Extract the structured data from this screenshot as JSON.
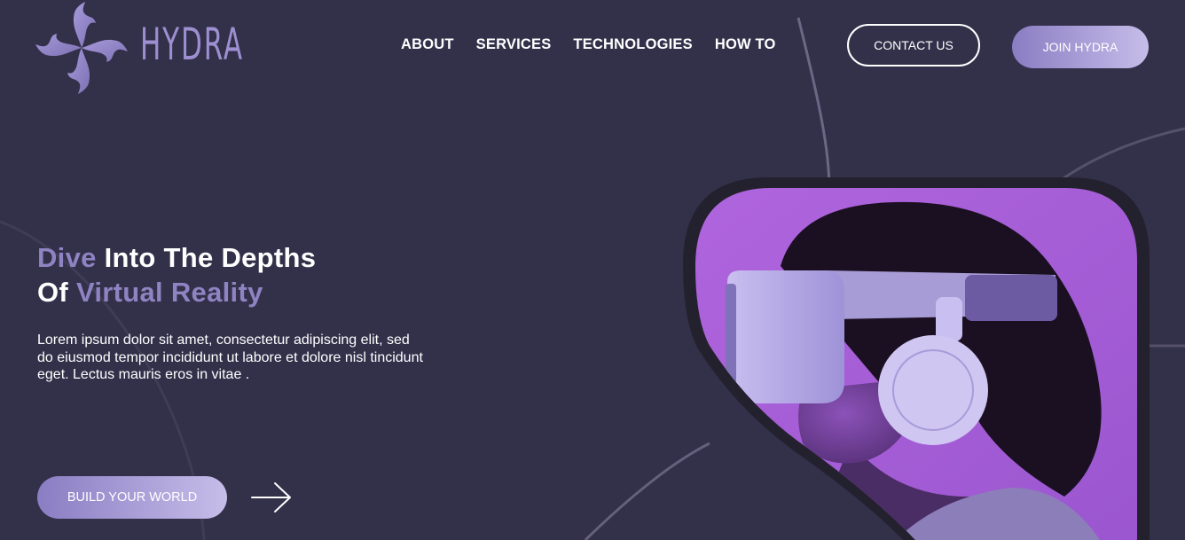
{
  "brand": {
    "name": "HYDRA",
    "logo_icon": "hydra-logo-icon"
  },
  "nav": {
    "items": [
      {
        "label": "ABOUT"
      },
      {
        "label": "SERVICES"
      },
      {
        "label": "TECHNOLOGIES"
      },
      {
        "label": "HOW TO"
      }
    ]
  },
  "header": {
    "contact_label": "CONTACT US",
    "join_label": "JOIN HYDRA"
  },
  "hero": {
    "title_line1_accent": "Dive",
    "title_line1_rest": " Into The Depths",
    "title_line2_start": "Of ",
    "title_line2_accent": "Virtual Reality",
    "description": "Lorem ipsum dolor sit amet, consectetur adipiscing elit, sed do eiusmod tempor incididunt ut labore et dolore nisl tincidunt eget. Lectus mauris eros in vitae .",
    "cta_label": "BUILD YOUR WORLD",
    "cta_arrow_icon": "arrow-right-icon",
    "image_subject": "person-wearing-vr-headset-photo"
  },
  "colors": {
    "background": "#33304a",
    "accent": "#8f83c2",
    "button_gradient_start": "#8a7dc3",
    "button_gradient_end": "#c6bde9",
    "image_background": "#a35fd6"
  }
}
